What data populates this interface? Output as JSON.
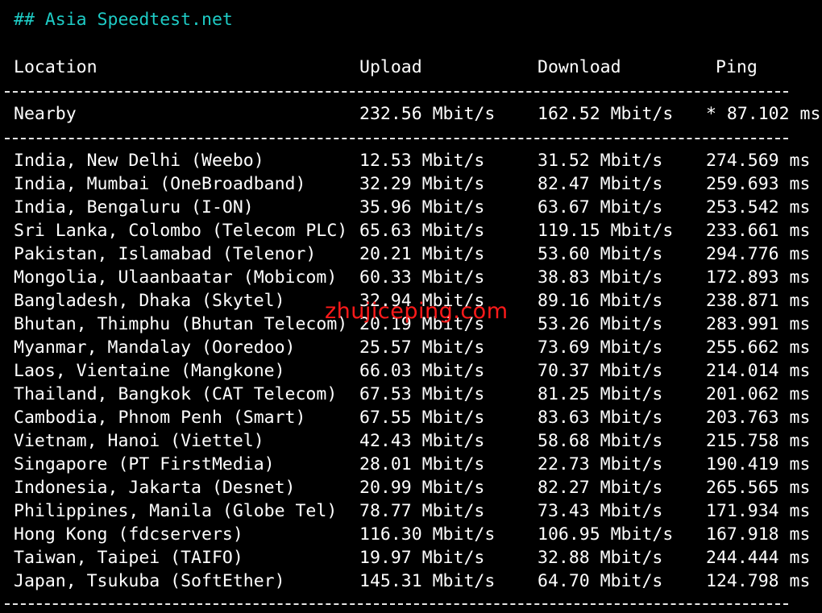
{
  "title": "## Asia Speedtest.net",
  "headers": {
    "location": "Location",
    "upload": "Upload",
    "download": "Download",
    "ping": "Ping"
  },
  "nearby": {
    "location": "Nearby",
    "upload": "232.56 Mbit/s",
    "download": "162.52 Mbit/s",
    "ping": "* 87.102 ms"
  },
  "rows": [
    {
      "location": "India, New Delhi (Weebo)",
      "upload": "12.53 Mbit/s",
      "download": "31.52 Mbit/s",
      "ping": "274.569 ms"
    },
    {
      "location": "India, Mumbai (OneBroadband)",
      "upload": "32.29 Mbit/s",
      "download": "82.47 Mbit/s",
      "ping": "259.693 ms"
    },
    {
      "location": "India, Bengaluru (I-ON)",
      "upload": "35.96 Mbit/s",
      "download": "63.67 Mbit/s",
      "ping": "253.542 ms"
    },
    {
      "location": "Sri Lanka, Colombo (Telecom PLC)",
      "upload": "65.63 Mbit/s",
      "download": "119.15 Mbit/s",
      "ping": "233.661 ms"
    },
    {
      "location": "Pakistan, Islamabad (Telenor)",
      "upload": "20.21 Mbit/s",
      "download": "53.60 Mbit/s",
      "ping": "294.776 ms"
    },
    {
      "location": "Mongolia, Ulaanbaatar (Mobicom)",
      "upload": "60.33 Mbit/s",
      "download": "38.83 Mbit/s",
      "ping": "172.893 ms"
    },
    {
      "location": "Bangladesh, Dhaka (Skytel)",
      "upload": "32.94 Mbit/s",
      "download": "89.16 Mbit/s",
      "ping": "238.871 ms"
    },
    {
      "location": "Bhutan, Thimphu (Bhutan Telecom)",
      "upload": "20.19 Mbit/s",
      "download": "53.26 Mbit/s",
      "ping": "283.991 ms"
    },
    {
      "location": "Myanmar, Mandalay (Ooredoo)",
      "upload": "25.57 Mbit/s",
      "download": "73.69 Mbit/s",
      "ping": "255.662 ms"
    },
    {
      "location": "Laos, Vientaine (Mangkone)",
      "upload": "66.03 Mbit/s",
      "download": "70.37 Mbit/s",
      "ping": "214.014 ms"
    },
    {
      "location": "Thailand, Bangkok (CAT Telecom)",
      "upload": "67.53 Mbit/s",
      "download": "81.25 Mbit/s",
      "ping": "201.062 ms"
    },
    {
      "location": "Cambodia, Phnom Penh (Smart)",
      "upload": "67.55 Mbit/s",
      "download": "83.63 Mbit/s",
      "ping": "203.763 ms"
    },
    {
      "location": "Vietnam, Hanoi (Viettel)",
      "upload": "42.43 Mbit/s",
      "download": "58.68 Mbit/s",
      "ping": "215.758 ms"
    },
    {
      "location": "Singapore (PT FirstMedia)",
      "upload": "28.01 Mbit/s",
      "download": "22.73 Mbit/s",
      "ping": "190.419 ms"
    },
    {
      "location": "Indonesia, Jakarta (Desnet)",
      "upload": "20.99 Mbit/s",
      "download": "82.27 Mbit/s",
      "ping": "265.565 ms"
    },
    {
      "location": "Philippines, Manila (Globe Tel)",
      "upload": "78.77 Mbit/s",
      "download": "73.43 Mbit/s",
      "ping": "171.934 ms"
    },
    {
      "location": "Hong Kong (fdcservers)",
      "upload": "116.30 Mbit/s",
      "download": "106.95 Mbit/s",
      "ping": "167.918 ms"
    },
    {
      "location": "Taiwan, Taipei (TAIFO)",
      "upload": "19.97 Mbit/s",
      "download": "32.88 Mbit/s",
      "ping": "244.444 ms"
    },
    {
      "location": "Japan, Tsukuba (SoftEther)",
      "upload": "145.31 Mbit/s",
      "download": "64.70 Mbit/s",
      "ping": "124.798 ms"
    }
  ],
  "watermark": "zhujiceping.com",
  "colors": {
    "title": "#1ecbc5",
    "text": "#ffffff",
    "background": "#000000",
    "watermark": "#ff1a1a"
  }
}
